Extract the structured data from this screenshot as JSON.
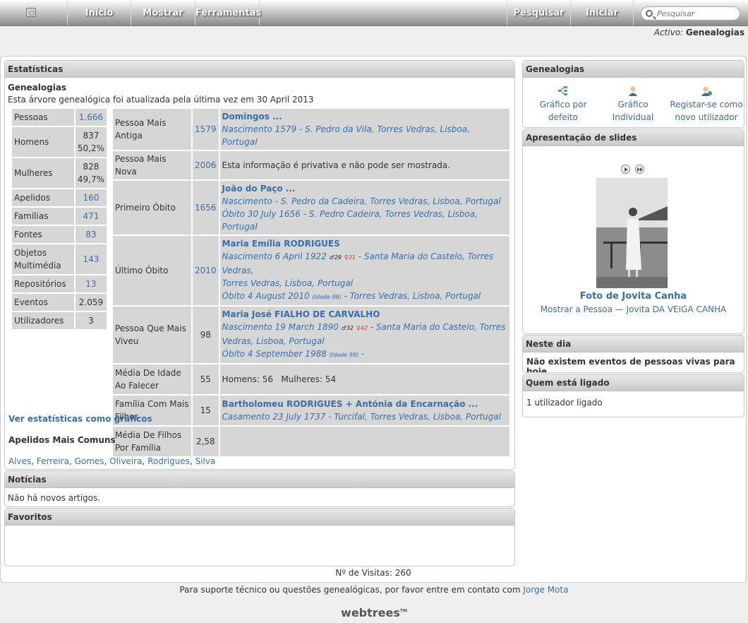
{
  "nav": {
    "home_icon": "home-icon",
    "inicio": "Início",
    "mostrar": "Mostrar",
    "ferramentas": "Ferramentas",
    "pesquisar": "Pesquisar",
    "iniciar": "Iniciar",
    "search_placeholder": "Pesquisar"
  },
  "active": {
    "label": "Activo:",
    "value": "Genealogias"
  },
  "stats": {
    "title": "Estatísticas",
    "subtitle": "Genealogias",
    "updated": "Esta árvore genealógica foi atualizada pela última vez em 30 April 2013",
    "left": [
      {
        "label": "Pessoas",
        "value": "1.666",
        "link": true
      },
      {
        "label": "Homens",
        "value": "837",
        "pct": "50,2%",
        "link": false
      },
      {
        "label": "Mulheres",
        "value": "828",
        "pct": "49,7%",
        "link": false
      },
      {
        "label": "Apelidos",
        "value": "160",
        "link": true
      },
      {
        "label": "Famílias",
        "value": "471",
        "link": true
      },
      {
        "label": "Fontes",
        "value": "83",
        "link": true
      },
      {
        "label": "Objetos Multimédia",
        "value": "143",
        "link": true
      },
      {
        "label": "Repositórios",
        "value": "13",
        "link": true
      },
      {
        "label": "Eventos",
        "value": "2.059",
        "link": false
      },
      {
        "label": "Utilizadores",
        "value": "3",
        "link": false
      }
    ],
    "right": {
      "r1": {
        "label": "Pessoa Mais Antiga",
        "num": "1579",
        "name": "Domingos ...",
        "l1": "Nascimento 1579 - S. Pedro da Vila, Torres Vedras, Lisboa, Portugal"
      },
      "r2": {
        "label": "Pessoa Mais Nova",
        "num": "2006",
        "text": "Esta informação é privativa e não pode ser mostrada."
      },
      "r3": {
        "label": "Primeiro Óbito",
        "num": "1656",
        "name": "João do Paço ...",
        "l1": "Nascimento - S. Pedro da Cadeira, Torres Vedras, Lisboa, Portugal",
        "l2": "Óbito 30 July 1656 - S. Pedro Cadeira, Torres Vedras, Lisboa, Portugal"
      },
      "r4": {
        "label": "Último Óbito",
        "num": "2010",
        "name": "Maria Emília RODRIGUES",
        "l1a": "Nascimento 6 April 1922",
        "m": "♂29",
        "f": "♀31",
        "l1b": "- Santa Maria do Castelo, Torres Vedras,",
        "l1c": "Torres Vedras, Lisboa, Portugal",
        "l2a": "Óbito 4 August 2010",
        "age": "(Idade 88)",
        "l2b": "- Torres Vedras, Lisboa, Portugal"
      },
      "r5": {
        "label": "Pessoa Que Mais Viveu",
        "num": "98",
        "name": "Maria José FIALHO DE CARVALHO",
        "l1a": "Nascimento 19 March 1890",
        "m": "♂32",
        "f": "♀42",
        "l1b": "- Santa Maria do Castelo, Torres",
        "l1c": "Vedras, Lisboa, Portugal",
        "l2a": "Óbito 4 September 1988",
        "age": "(Idade 98)",
        "l2b": "-"
      },
      "r6": {
        "label": "Média De Idade Ao Falecer",
        "num": "55",
        "text": "Homens: 56   Mulheres: 54"
      },
      "r7": {
        "label": "Família Com Mais Filhos",
        "num": "15",
        "name": "Bartholomeu RODRIGUES + Antónia da Encarnação ...",
        "l1": "Casamento 23 July 1737 - Turcifal, Torres Vedras, Lisboa, Portugal"
      },
      "r8": {
        "label": "Média De Filhos Por Família",
        "num": "2,58"
      }
    },
    "graph_link": "Ver estatísticas como gráficos",
    "common_title": "Apelidos Mais Comuns",
    "surnames": [
      "Alves",
      "Ferreira",
      "Gomes",
      "Oliveira",
      "Rodrigues",
      "Silva"
    ]
  },
  "news": {
    "title": "Notícias",
    "text": "Não há novos artigos."
  },
  "fav": {
    "title": "Favoritos"
  },
  "visits": {
    "label": "Nº de Visitas:",
    "value": "260"
  },
  "gen": {
    "title": "Genealogias",
    "a": "Gráfico por defeito",
    "b": "Gráfico Individual",
    "c": "Registar-se como novo utilizador"
  },
  "slides": {
    "title": "Apresentação de slides",
    "caption": "Foto de Jovita Canha",
    "link": "Mostrar a Pessoa — Jovita DA VEIGA CANHA"
  },
  "today": {
    "title": "Neste dia",
    "text": "Não existem eventos de pessoas vivas para hoje."
  },
  "online": {
    "title": "Quem está ligado",
    "text": "1 utilizador ligado"
  },
  "footer": {
    "text": "Para suporte técnico ou questões genealógicas, por favor entre em contato com",
    "contact": "Jorge Mota",
    "logo": "webtrees"
  }
}
